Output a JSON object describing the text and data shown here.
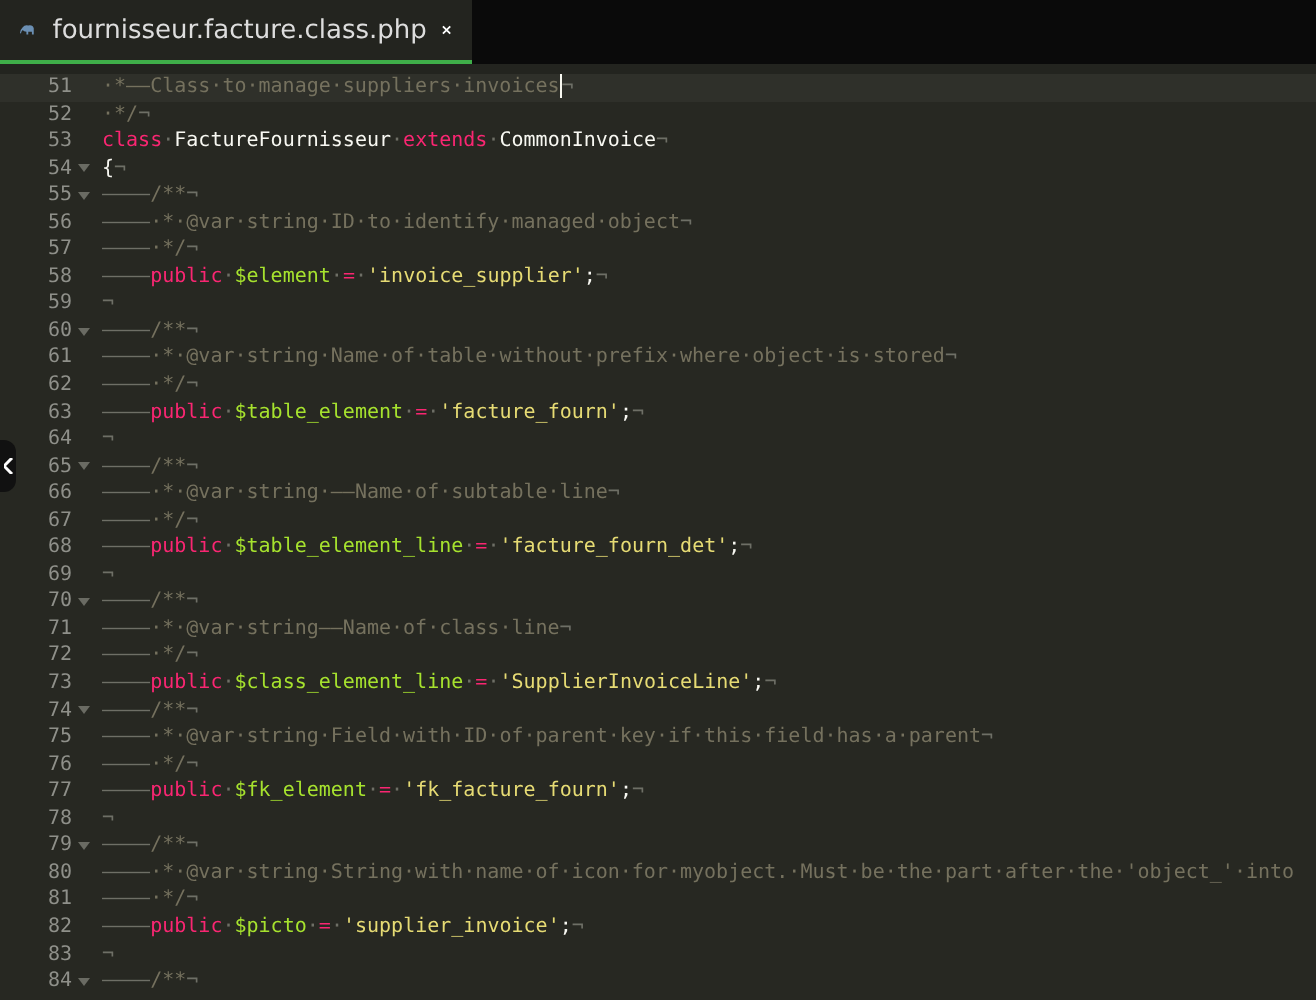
{
  "tab": {
    "title": "fournisseur.facture.class.php",
    "selected": true
  },
  "editor": {
    "lines": [
      {
        "number": "51",
        "foldable": false,
        "current": true,
        "tokens": [
          {
            "kind": "comment",
            "text": "·*——Class·to·manage·suppliers·invoices"
          },
          {
            "kind": "eol",
            "text": "¬"
          }
        ]
      },
      {
        "number": "52",
        "foldable": false,
        "current": false,
        "tokens": [
          {
            "kind": "comment",
            "text": "·*/"
          },
          {
            "kind": "eol",
            "text": "¬"
          }
        ]
      },
      {
        "number": "53",
        "foldable": false,
        "current": false,
        "tokens": [
          {
            "kind": "keyword",
            "text": "class"
          },
          {
            "kind": "ws",
            "text": "·"
          },
          {
            "kind": "name",
            "text": "FactureFournisseur"
          },
          {
            "kind": "ws",
            "text": "·"
          },
          {
            "kind": "keyword",
            "text": "extends"
          },
          {
            "kind": "ws",
            "text": "·"
          },
          {
            "kind": "name",
            "text": "CommonInvoice"
          },
          {
            "kind": "eol",
            "text": "¬"
          }
        ]
      },
      {
        "number": "54",
        "foldable": true,
        "current": false,
        "tokens": [
          {
            "kind": "name",
            "text": "{"
          },
          {
            "kind": "eol",
            "text": "¬"
          }
        ]
      },
      {
        "number": "55",
        "foldable": true,
        "current": false,
        "tokens": [
          {
            "kind": "ws",
            "text": "————"
          },
          {
            "kind": "comment",
            "text": "/**"
          },
          {
            "kind": "eol",
            "text": "¬"
          }
        ]
      },
      {
        "number": "56",
        "foldable": false,
        "current": false,
        "tokens": [
          {
            "kind": "ws",
            "text": "————"
          },
          {
            "kind": "comment",
            "text": "·*·@var·string·ID·to·identify·managed·object"
          },
          {
            "kind": "eol",
            "text": "¬"
          }
        ]
      },
      {
        "number": "57",
        "foldable": false,
        "current": false,
        "tokens": [
          {
            "kind": "ws",
            "text": "————"
          },
          {
            "kind": "comment",
            "text": "·*/"
          },
          {
            "kind": "eol",
            "text": "¬"
          }
        ]
      },
      {
        "number": "58",
        "foldable": false,
        "current": false,
        "tokens": [
          {
            "kind": "ws",
            "text": "————"
          },
          {
            "kind": "keyword",
            "text": "public"
          },
          {
            "kind": "ws",
            "text": "·"
          },
          {
            "kind": "variable",
            "text": "$element"
          },
          {
            "kind": "ws",
            "text": "·"
          },
          {
            "kind": "keyword",
            "text": "="
          },
          {
            "kind": "ws",
            "text": "·"
          },
          {
            "kind": "string",
            "text": "'invoice_supplier'"
          },
          {
            "kind": "name",
            "text": ";"
          },
          {
            "kind": "eol",
            "text": "¬"
          }
        ]
      },
      {
        "number": "59",
        "foldable": false,
        "current": false,
        "tokens": [
          {
            "kind": "eol",
            "text": "¬"
          }
        ]
      },
      {
        "number": "60",
        "foldable": true,
        "current": false,
        "tokens": [
          {
            "kind": "ws",
            "text": "————"
          },
          {
            "kind": "comment",
            "text": "/**"
          },
          {
            "kind": "eol",
            "text": "¬"
          }
        ]
      },
      {
        "number": "61",
        "foldable": false,
        "current": false,
        "tokens": [
          {
            "kind": "ws",
            "text": "————"
          },
          {
            "kind": "comment",
            "text": "·*·@var·string·Name·of·table·without·prefix·where·object·is·stored"
          },
          {
            "kind": "eol",
            "text": "¬"
          }
        ]
      },
      {
        "number": "62",
        "foldable": false,
        "current": false,
        "tokens": [
          {
            "kind": "ws",
            "text": "————"
          },
          {
            "kind": "comment",
            "text": "·*/"
          },
          {
            "kind": "eol",
            "text": "¬"
          }
        ]
      },
      {
        "number": "63",
        "foldable": false,
        "current": false,
        "tokens": [
          {
            "kind": "ws",
            "text": "————"
          },
          {
            "kind": "keyword",
            "text": "public"
          },
          {
            "kind": "ws",
            "text": "·"
          },
          {
            "kind": "variable",
            "text": "$table_element"
          },
          {
            "kind": "ws",
            "text": "·"
          },
          {
            "kind": "keyword",
            "text": "="
          },
          {
            "kind": "ws",
            "text": "·"
          },
          {
            "kind": "string",
            "text": "'facture_fourn'"
          },
          {
            "kind": "name",
            "text": ";"
          },
          {
            "kind": "eol",
            "text": "¬"
          }
        ]
      },
      {
        "number": "64",
        "foldable": false,
        "current": false,
        "tokens": [
          {
            "kind": "eol",
            "text": "¬"
          }
        ]
      },
      {
        "number": "65",
        "foldable": true,
        "current": false,
        "tokens": [
          {
            "kind": "ws",
            "text": "————"
          },
          {
            "kind": "comment",
            "text": "/**"
          },
          {
            "kind": "eol",
            "text": "¬"
          }
        ]
      },
      {
        "number": "66",
        "foldable": false,
        "current": false,
        "tokens": [
          {
            "kind": "ws",
            "text": "————"
          },
          {
            "kind": "comment",
            "text": "·*·@var·string·——Name·of·subtable·line"
          },
          {
            "kind": "eol",
            "text": "¬"
          }
        ]
      },
      {
        "number": "67",
        "foldable": false,
        "current": false,
        "tokens": [
          {
            "kind": "ws",
            "text": "————"
          },
          {
            "kind": "comment",
            "text": "·*/"
          },
          {
            "kind": "eol",
            "text": "¬"
          }
        ]
      },
      {
        "number": "68",
        "foldable": false,
        "current": false,
        "tokens": [
          {
            "kind": "ws",
            "text": "————"
          },
          {
            "kind": "keyword",
            "text": "public"
          },
          {
            "kind": "ws",
            "text": "·"
          },
          {
            "kind": "variable",
            "text": "$table_element_line"
          },
          {
            "kind": "ws",
            "text": "·"
          },
          {
            "kind": "keyword",
            "text": "="
          },
          {
            "kind": "ws",
            "text": "·"
          },
          {
            "kind": "string",
            "text": "'facture_fourn_det'"
          },
          {
            "kind": "name",
            "text": ";"
          },
          {
            "kind": "eol",
            "text": "¬"
          }
        ]
      },
      {
        "number": "69",
        "foldable": false,
        "current": false,
        "tokens": [
          {
            "kind": "eol",
            "text": "¬"
          }
        ]
      },
      {
        "number": "70",
        "foldable": true,
        "current": false,
        "tokens": [
          {
            "kind": "ws",
            "text": "————"
          },
          {
            "kind": "comment",
            "text": "/**"
          },
          {
            "kind": "eol",
            "text": "¬"
          }
        ]
      },
      {
        "number": "71",
        "foldable": false,
        "current": false,
        "tokens": [
          {
            "kind": "ws",
            "text": "————"
          },
          {
            "kind": "comment",
            "text": "·*·@var·string——Name·of·class·line"
          },
          {
            "kind": "eol",
            "text": "¬"
          }
        ]
      },
      {
        "number": "72",
        "foldable": false,
        "current": false,
        "tokens": [
          {
            "kind": "ws",
            "text": "————"
          },
          {
            "kind": "comment",
            "text": "·*/"
          },
          {
            "kind": "eol",
            "text": "¬"
          }
        ]
      },
      {
        "number": "73",
        "foldable": false,
        "current": false,
        "tokens": [
          {
            "kind": "ws",
            "text": "————"
          },
          {
            "kind": "keyword",
            "text": "public"
          },
          {
            "kind": "ws",
            "text": "·"
          },
          {
            "kind": "variable",
            "text": "$class_element_line"
          },
          {
            "kind": "ws",
            "text": "·"
          },
          {
            "kind": "keyword",
            "text": "="
          },
          {
            "kind": "ws",
            "text": "·"
          },
          {
            "kind": "string",
            "text": "'SupplierInvoiceLine'"
          },
          {
            "kind": "name",
            "text": ";"
          },
          {
            "kind": "eol",
            "text": "¬"
          }
        ]
      },
      {
        "number": "74",
        "foldable": true,
        "current": false,
        "tokens": [
          {
            "kind": "ws",
            "text": "————"
          },
          {
            "kind": "comment",
            "text": "/**"
          },
          {
            "kind": "eol",
            "text": "¬"
          }
        ]
      },
      {
        "number": "75",
        "foldable": false,
        "current": false,
        "tokens": [
          {
            "kind": "ws",
            "text": "————"
          },
          {
            "kind": "comment",
            "text": "·*·@var·string·Field·with·ID·of·parent·key·if·this·field·has·a·parent"
          },
          {
            "kind": "eol",
            "text": "¬"
          }
        ]
      },
      {
        "number": "76",
        "foldable": false,
        "current": false,
        "tokens": [
          {
            "kind": "ws",
            "text": "————"
          },
          {
            "kind": "comment",
            "text": "·*/"
          },
          {
            "kind": "eol",
            "text": "¬"
          }
        ]
      },
      {
        "number": "77",
        "foldable": false,
        "current": false,
        "tokens": [
          {
            "kind": "ws",
            "text": "————"
          },
          {
            "kind": "keyword",
            "text": "public"
          },
          {
            "kind": "ws",
            "text": "·"
          },
          {
            "kind": "variable",
            "text": "$fk_element"
          },
          {
            "kind": "ws",
            "text": "·"
          },
          {
            "kind": "keyword",
            "text": "="
          },
          {
            "kind": "ws",
            "text": "·"
          },
          {
            "kind": "string",
            "text": "'fk_facture_fourn'"
          },
          {
            "kind": "name",
            "text": ";"
          },
          {
            "kind": "eol",
            "text": "¬"
          }
        ]
      },
      {
        "number": "78",
        "foldable": false,
        "current": false,
        "tokens": [
          {
            "kind": "eol",
            "text": "¬"
          }
        ]
      },
      {
        "number": "79",
        "foldable": true,
        "current": false,
        "tokens": [
          {
            "kind": "ws",
            "text": "————"
          },
          {
            "kind": "comment",
            "text": "/**"
          },
          {
            "kind": "eol",
            "text": "¬"
          }
        ]
      },
      {
        "number": "80",
        "foldable": false,
        "current": false,
        "tokens": [
          {
            "kind": "ws",
            "text": "————"
          },
          {
            "kind": "comment",
            "text": "·*·@var·string·String·with·name·of·icon·for·myobject.·Must·be·the·part·after·the·'object_'·into"
          }
        ]
      },
      {
        "number": "81",
        "foldable": false,
        "current": false,
        "tokens": [
          {
            "kind": "ws",
            "text": "————"
          },
          {
            "kind": "comment",
            "text": "·*/"
          },
          {
            "kind": "eol",
            "text": "¬"
          }
        ]
      },
      {
        "number": "82",
        "foldable": false,
        "current": false,
        "tokens": [
          {
            "kind": "ws",
            "text": "————"
          },
          {
            "kind": "keyword",
            "text": "public"
          },
          {
            "kind": "ws",
            "text": "·"
          },
          {
            "kind": "variable",
            "text": "$picto"
          },
          {
            "kind": "ws",
            "text": "·"
          },
          {
            "kind": "keyword",
            "text": "="
          },
          {
            "kind": "ws",
            "text": "·"
          },
          {
            "kind": "string",
            "text": "'supplier_invoice'"
          },
          {
            "kind": "name",
            "text": ";"
          },
          {
            "kind": "eol",
            "text": "¬"
          }
        ]
      },
      {
        "number": "83",
        "foldable": false,
        "current": false,
        "tokens": [
          {
            "kind": "eol",
            "text": "¬"
          }
        ]
      },
      {
        "number": "84",
        "foldable": true,
        "current": false,
        "tokens": [
          {
            "kind": "ws",
            "text": "————"
          },
          {
            "kind": "comment",
            "text": "/**"
          },
          {
            "kind": "eol",
            "text": "¬"
          }
        ]
      }
    ]
  }
}
